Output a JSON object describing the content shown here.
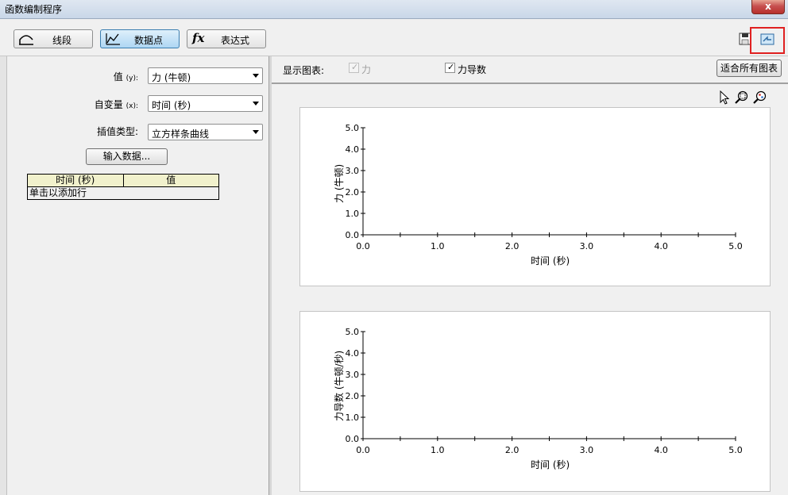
{
  "window": {
    "title": "函数编制程序",
    "close_label": "x"
  },
  "toolbar": {
    "tabs": [
      {
        "label": "线段",
        "icon": "arc-curve-icon",
        "active": false
      },
      {
        "label": "数据点",
        "icon": "data-points-icon",
        "active": true
      },
      {
        "label": "表达式",
        "icon": "fx-icon",
        "active": false
      }
    ],
    "fx_glyph": "fx",
    "right_icons": [
      "save-icon",
      "open-folder-icon"
    ]
  },
  "left": {
    "value_label": "值",
    "value_suffix": "(y):",
    "value_selected": "力 (牛顿)",
    "var_label": "自变量",
    "var_suffix": "(x):",
    "var_selected": "时间 (秒)",
    "interp_label": "插值类型:",
    "interp_selected": "立方样条曲线",
    "input_button": "输入数据...",
    "grid": {
      "columns": [
        "时间 (秒)",
        "值"
      ],
      "add_row_text": "单击以添加行"
    }
  },
  "right": {
    "show_label": "显示图表:",
    "checkbox_force": {
      "label": "力",
      "checked": true,
      "disabled": true
    },
    "checkbox_deriv": {
      "label": "力导数",
      "checked": true,
      "disabled": false
    },
    "fit_button": "适合所有图表",
    "tool_icons": [
      "pointer-icon",
      "zoom-box-icon",
      "zoom-icon"
    ]
  },
  "chart_data": [
    {
      "type": "line",
      "xlabel": "时间 (秒)",
      "ylabel": "力 (牛顿)",
      "xlim": [
        0,
        5
      ],
      "ylim": [
        0,
        5
      ],
      "xticks": [
        "0.0",
        "1.0",
        "2.0",
        "3.0",
        "4.0",
        "5.0"
      ],
      "yticks": [
        "0.0",
        "1.0",
        "2.0",
        "3.0",
        "4.0",
        "5.0"
      ],
      "series": []
    },
    {
      "type": "line",
      "xlabel": "时间 (秒)",
      "ylabel": "力导数 (牛顿/秒)",
      "xlim": [
        0,
        5
      ],
      "ylim": [
        0,
        5
      ],
      "xticks": [
        "0.0",
        "1.0",
        "2.0",
        "3.0",
        "4.0",
        "5.0"
      ],
      "yticks": [
        "0.0",
        "1.0",
        "2.0",
        "3.0",
        "4.0",
        "5.0"
      ],
      "series": []
    }
  ],
  "colors": {
    "highlight": "#e02020",
    "active_tab": "#aed6f3",
    "grid_header": "#f1f1cc"
  }
}
